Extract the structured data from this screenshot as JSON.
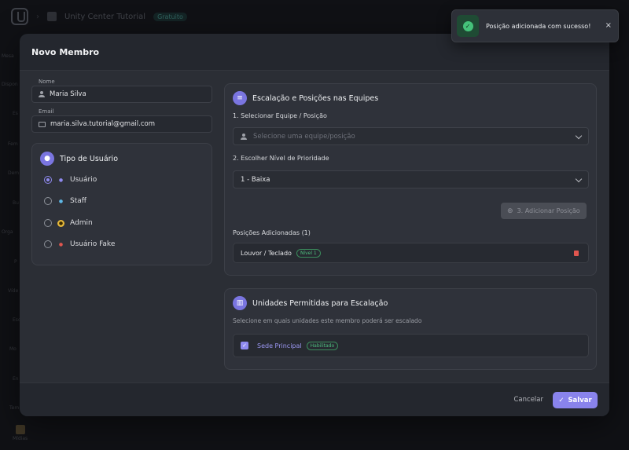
{
  "background": {
    "org_name": "Unity Center Tutorial",
    "org_badge": "Gratuito",
    "side_labels": [
      "Mesa",
      "Dispon",
      "Es",
      "Fem",
      "Dem",
      "Bu",
      "Orga",
      "P",
      "Víde",
      "Esc",
      "Mo",
      "En",
      "Tem",
      "Mídias"
    ]
  },
  "modal": {
    "title": "Novo Membro",
    "name": {
      "label": "Nome",
      "value": "Maria Silva"
    },
    "email": {
      "label": "Email",
      "value": "maria.silva.tutorial@gmail.com"
    },
    "user_type": {
      "title": "Tipo de Usuário",
      "options": [
        {
          "label": "Usuário",
          "selected": true,
          "icon": "user-icon",
          "color": "#8f8aef"
        },
        {
          "label": "Staff",
          "selected": false,
          "icon": "staff-icon",
          "color": "#5fb8e6"
        },
        {
          "label": "Admin",
          "selected": false,
          "icon": "admin-shield-icon",
          "color": "#e7b93a"
        },
        {
          "label": "Usuário Fake",
          "selected": false,
          "icon": "fake-user-icon",
          "color": "#e0564f"
        }
      ]
    },
    "teams": {
      "title": "Escalação e Posições nas Equipes",
      "step1_label": "1. Selecionar Equipe / Posição",
      "step1_placeholder": "Selecione uma equipe/posição",
      "step2_label": "2. Escolher Nível de Prioridade",
      "step2_value": "1 - Baixa",
      "add_button": "3. Adicionar Posição",
      "added_label": "Posições Adicionadas (1)",
      "added": [
        {
          "name": "Louvor / Teclado",
          "level": "Nível 1"
        }
      ]
    },
    "units": {
      "title": "Unidades Permitidas para Escalação",
      "subtitle": "Selecione em quais unidades este membro poderá ser escalado",
      "items": [
        {
          "name": "Sede Principal",
          "status": "Habilitado",
          "checked": true
        }
      ]
    },
    "footer": {
      "cancel": "Cancelar",
      "save": "Salvar"
    }
  },
  "toast": {
    "message": "Posição adicionada com sucesso!",
    "close": "×"
  },
  "colors": {
    "accent": "#8983ec",
    "success": "#45c27a",
    "danger": "#e0564f"
  }
}
